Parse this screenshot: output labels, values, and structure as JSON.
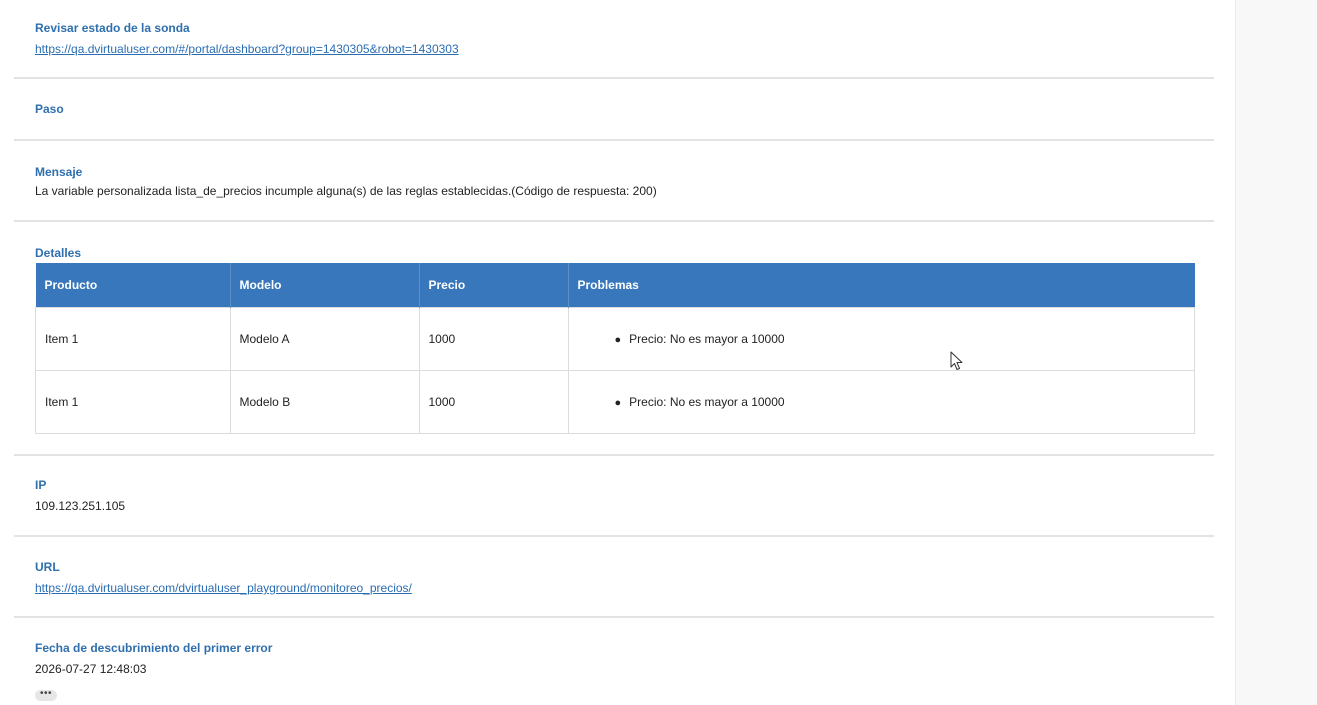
{
  "revisar": {
    "label": "Revisar estado de la sonda",
    "link": "https://qa.dvirtualuser.com/#/portal/dashboard?group=1430305&robot=1430303"
  },
  "paso": {
    "label": "Paso"
  },
  "mensaje": {
    "label": "Mensaje",
    "text": "La variable personalizada lista_de_precios incumple alguna(s) de las reglas establecidas.(Código de respuesta: 200)"
  },
  "detalles": {
    "label": "Detalles",
    "columns": [
      "Producto",
      "Modelo",
      "Precio",
      "Problemas"
    ],
    "rows": [
      {
        "producto": "Item 1",
        "modelo": "Modelo A",
        "precio": "1000",
        "problema": "Precio: No es mayor a 10000"
      },
      {
        "producto": "Item 1",
        "modelo": "Modelo B",
        "precio": "1000",
        "problema": "Precio: No es mayor a 10000"
      }
    ],
    "header_color": "#3877bb"
  },
  "ip": {
    "label": "IP",
    "value": "109.123.251.105"
  },
  "url": {
    "label": "URL",
    "link": "https://qa.dvirtualuser.com/dvirtualuser_playground/monitoreo_precios/"
  },
  "fecha": {
    "label": "Fecha de descubrimiento del primer error",
    "value": "2026-07-27 12:48:03",
    "more_label": "•••"
  },
  "colors": {
    "label": "#2f6fae",
    "link": "#2a6db3",
    "divider": "#e3e3e3"
  },
  "icons": {
    "cursor": "mouse-pointer-icon",
    "more": "ellipsis-icon"
  }
}
